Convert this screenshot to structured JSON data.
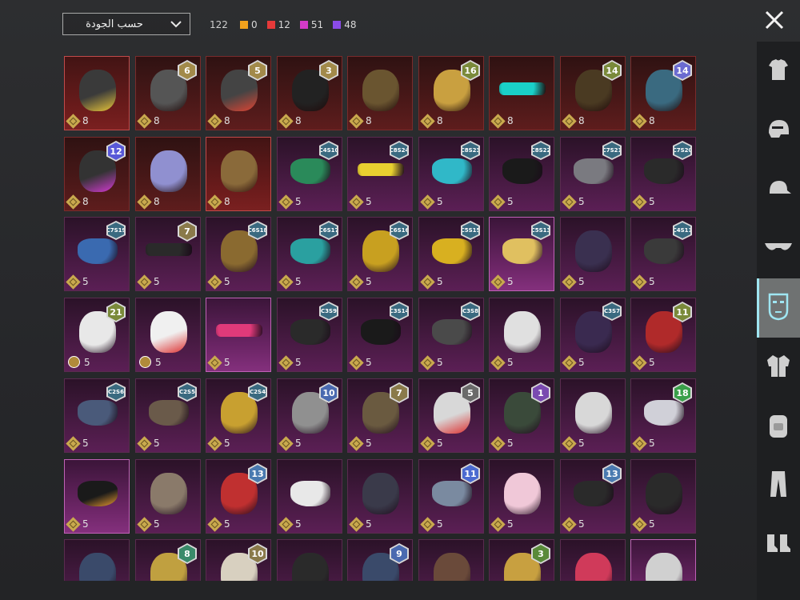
{
  "toolbar": {
    "sort_label": "حسب الجودة",
    "total_count": "122",
    "counters": [
      {
        "color": "#f2a21c",
        "value": "0"
      },
      {
        "color": "#e53a3a",
        "value": "12"
      },
      {
        "color": "#d33bc8",
        "value": "51"
      },
      {
        "color": "#8a4be8",
        "value": "48"
      }
    ]
  },
  "sidebar": {
    "items": [
      {
        "icon": "outfit-icon"
      },
      {
        "icon": "helmet-icon"
      },
      {
        "icon": "cap-icon"
      },
      {
        "icon": "glasses-icon"
      },
      {
        "icon": "mask-icon",
        "active": true
      },
      {
        "icon": "jacket-icon"
      },
      {
        "icon": "backpack-icon"
      },
      {
        "icon": "pants-icon"
      },
      {
        "icon": "shoes-icon"
      }
    ]
  },
  "grid": {
    "rows": [
      [
        {
          "tier": "sel-red",
          "badge": "",
          "cost": "8",
          "art": "#3a3a3a",
          "accent": "#e8c53a"
        },
        {
          "tier": "red",
          "badge": "6",
          "badge_color": "#a28a4a",
          "cost": "8",
          "art": "#555555"
        },
        {
          "tier": "red",
          "badge": "5",
          "badge_color": "#a28a4a",
          "cost": "8",
          "art": "#444444",
          "accent": "#d43"
        },
        {
          "tier": "red",
          "badge": "3",
          "badge_color": "#a28a4a",
          "cost": "8",
          "art": "#222222"
        },
        {
          "tier": "red",
          "badge": "",
          "cost": "8",
          "art": "#6a5530"
        },
        {
          "tier": "red",
          "badge": "16",
          "badge_color": "#7a8a3a",
          "cost": "8",
          "art": "#c9a040"
        },
        {
          "tier": "red",
          "badge": "",
          "cost": "8",
          "art": "#1ad0c8",
          "shape": "visor"
        },
        {
          "tier": "red",
          "badge": "14",
          "badge_color": "#7a8a3a",
          "cost": "8",
          "art": "#4a3a22"
        },
        {
          "tier": "red",
          "badge": "14",
          "badge_color": "#6b6bd0",
          "cost": "8",
          "art": "#3a6a80"
        }
      ],
      [
        {
          "tier": "red",
          "badge": "12",
          "badge_color": "#5858d8",
          "cost": "8",
          "art": "#333333",
          "accent": "#d23ad0"
        },
        {
          "tier": "red",
          "badge": "",
          "cost": "8",
          "art": "#9090d0"
        },
        {
          "tier": "sel-red",
          "badge": "",
          "cost": "8",
          "art": "#8a6a3a"
        },
        {
          "tier": "pink",
          "badge": "C4S10",
          "badge_color": "#3a6a80",
          "season": true,
          "cost": "5",
          "art": "#2a8a5a",
          "shape": "mask"
        },
        {
          "tier": "pink",
          "badge": "C8S24",
          "badge_color": "#3a6a80",
          "season": true,
          "cost": "5",
          "art": "#e8d030",
          "shape": "visor"
        },
        {
          "tier": "pink",
          "badge": "C8S23",
          "badge_color": "#3a6a80",
          "season": true,
          "cost": "5",
          "art": "#30b8c8",
          "shape": "mask"
        },
        {
          "tier": "pink",
          "badge": "C8S22",
          "badge_color": "#3a6a80",
          "season": true,
          "cost": "5",
          "art": "#1a1a1a",
          "shape": "mask"
        },
        {
          "tier": "pink",
          "badge": "C7S21",
          "badge_color": "#3a6a80",
          "season": true,
          "cost": "5",
          "art": "#7a7a80",
          "shape": "mask"
        },
        {
          "tier": "pink",
          "badge": "C7S20",
          "badge_color": "#3a6a80",
          "season": true,
          "cost": "5",
          "art": "#2a2a2a",
          "shape": "mask"
        }
      ],
      [
        {
          "tier": "pink",
          "badge": "C7S19",
          "badge_color": "#3a6a80",
          "season": true,
          "cost": "5",
          "art": "#3a6ab0",
          "shape": "mask"
        },
        {
          "tier": "pink",
          "badge": "7",
          "badge_color": "#8a7a4a",
          "cost": "5",
          "art": "#2a2a2a",
          "shape": "visor"
        },
        {
          "tier": "pink",
          "badge": "C6S18",
          "badge_color": "#3a6a80",
          "season": true,
          "cost": "5",
          "art": "#8a6a30"
        },
        {
          "tier": "pink",
          "badge": "C6S17",
          "badge_color": "#3a6a80",
          "season": true,
          "cost": "5",
          "art": "#2aa0a0",
          "shape": "mask"
        },
        {
          "tier": "pink",
          "badge": "C6S16",
          "badge_color": "#3a6a80",
          "season": true,
          "cost": "5",
          "art": "#c8a020"
        },
        {
          "tier": "pink",
          "badge": "C5S15",
          "badge_color": "#3a6a80",
          "season": true,
          "cost": "5",
          "art": "#d8b020",
          "shape": "mask"
        },
        {
          "tier": "sel-pink",
          "badge": "C5S13",
          "badge_color": "#3a6a80",
          "season": true,
          "cost": "5",
          "art": "#e0c060",
          "shape": "mask"
        },
        {
          "tier": "pink",
          "badge": "",
          "cost": "5",
          "art": "#3a3050"
        },
        {
          "tier": "pink",
          "badge": "C4S11",
          "badge_color": "#3a6a80",
          "season": true,
          "cost": "5",
          "art": "#3a3a3a",
          "shape": "mask"
        }
      ],
      [
        {
          "tier": "pink",
          "badge": "21",
          "badge_color": "#7a8a3a",
          "cost": "5",
          "round": true,
          "art": "#e8e8e8"
        },
        {
          "tier": "pink",
          "badge": "",
          "cost": "5",
          "round": true,
          "art": "#f0f0f0",
          "accent": "#d33"
        },
        {
          "tier": "sel-pink",
          "badge": "",
          "cost": "5",
          "art": "#e03a7a",
          "shape": "visor"
        },
        {
          "tier": "pink",
          "badge": "C3S9",
          "badge_color": "#3a6a80",
          "season": true,
          "cost": "5",
          "art": "#2a2a2a",
          "shape": "mask"
        },
        {
          "tier": "pink",
          "badge": "C3S14",
          "badge_color": "#3a6a80",
          "season": true,
          "cost": "5",
          "art": "#1a1a1a",
          "shape": "mask"
        },
        {
          "tier": "pink",
          "badge": "C3S8",
          "badge_color": "#3a6a80",
          "season": true,
          "cost": "5",
          "art": "#4a4a4a",
          "shape": "mask"
        },
        {
          "tier": "pink",
          "badge": "",
          "cost": "5",
          "art": "#e0e0e0"
        },
        {
          "tier": "pink",
          "badge": "C3S7",
          "badge_color": "#3a6a80",
          "season": true,
          "cost": "5",
          "art": "#3a2a50"
        },
        {
          "tier": "pink",
          "badge": "11",
          "badge_color": "#7a8a3a",
          "cost": "5",
          "art": "#b02a2a"
        }
      ],
      [
        {
          "tier": "pink",
          "badge": "C2S6",
          "badge_color": "#3a6a80",
          "season": true,
          "cost": "5",
          "art": "#4a5a7a",
          "shape": "mask"
        },
        {
          "tier": "pink",
          "badge": "C2S5",
          "badge_color": "#3a6a80",
          "season": true,
          "cost": "5",
          "art": "#6a5a4a",
          "shape": "mask"
        },
        {
          "tier": "pink",
          "badge": "C2S4",
          "badge_color": "#3a6a80",
          "season": true,
          "cost": "5",
          "art": "#c8a030"
        },
        {
          "tier": "pink",
          "badge": "10",
          "badge_color": "#4a6ab0",
          "cost": "5",
          "art": "#909090"
        },
        {
          "tier": "pink",
          "badge": "7",
          "badge_color": "#8a7a4a",
          "cost": "5",
          "art": "#6a5a40"
        },
        {
          "tier": "pink",
          "badge": "5",
          "badge_color": "#6a6a6a",
          "cost": "5",
          "art": "#d8d8d8",
          "accent": "#d33"
        },
        {
          "tier": "pink",
          "badge": "1",
          "badge_color": "#7a4ab0",
          "cost": "5",
          "art": "#3a4a3a"
        },
        {
          "tier": "pink",
          "badge": "",
          "cost": "5",
          "art": "#d8d8d8"
        },
        {
          "tier": "pink",
          "badge": "18",
          "badge_color": "#3aa04a",
          "cost": "5",
          "art": "#d0d0d8",
          "shape": "mask"
        }
      ],
      [
        {
          "tier": "sel-pink",
          "badge": "",
          "cost": "5",
          "art": "#1a1a1a",
          "shape": "mask",
          "accent": "#e89a30"
        },
        {
          "tier": "pink",
          "badge": "",
          "cost": "5",
          "art": "#8a7a6a"
        },
        {
          "tier": "pink",
          "badge": "13",
          "badge_color": "#4a7ab0",
          "cost": "5",
          "art": "#c03030"
        },
        {
          "tier": "pink",
          "badge": "",
          "cost": "5",
          "art": "#e8e8e8",
          "shape": "mask"
        },
        {
          "tier": "pink",
          "badge": "",
          "cost": "5",
          "art": "#3a3a4a"
        },
        {
          "tier": "pink",
          "badge": "11",
          "badge_color": "#4a6ad0",
          "cost": "5",
          "art": "#7a8aa0",
          "shape": "mask"
        },
        {
          "tier": "pink",
          "badge": "",
          "cost": "5",
          "art": "#f0c8d8"
        },
        {
          "tier": "pink",
          "badge": "13",
          "badge_color": "#4a7ab0",
          "cost": "5",
          "art": "#2a2a2a",
          "shape": "mask"
        },
        {
          "tier": "pink",
          "badge": "",
          "cost": "5",
          "art": "#2a2a2a"
        }
      ],
      [
        {
          "tier": "pink",
          "badge": "",
          "cost": "",
          "art": "#3a4a6a"
        },
        {
          "tier": "pink",
          "badge": "8",
          "badge_color": "#3a8a6a",
          "cost": "",
          "art": "#c0a040"
        },
        {
          "tier": "pink",
          "badge": "10",
          "badge_color": "#8a7a4a",
          "cost": "",
          "art": "#d8d0c0"
        },
        {
          "tier": "pink",
          "badge": "",
          "cost": "",
          "art": "#2a2a2a"
        },
        {
          "tier": "pink",
          "badge": "9",
          "badge_color": "#4a6ab0",
          "cost": "",
          "art": "#3a4a6a"
        },
        {
          "tier": "pink",
          "badge": "",
          "cost": "",
          "art": "#6a4a3a"
        },
        {
          "tier": "pink",
          "badge": "3",
          "badge_color": "#5a8a3a",
          "cost": "",
          "art": "#c8a040"
        },
        {
          "tier": "pink",
          "badge": "",
          "cost": "",
          "art": "#d03a5a"
        },
        {
          "tier": "sel-pink",
          "badge": "",
          "cost": "",
          "art": "#d0d0d0"
        }
      ]
    ]
  }
}
